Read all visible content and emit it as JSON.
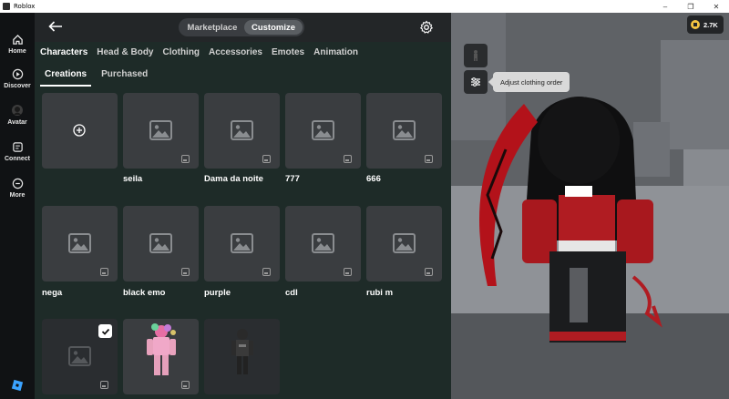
{
  "window": {
    "title": "Roblox"
  },
  "nav": {
    "items": [
      {
        "label": "Home",
        "icon": "home-icon"
      },
      {
        "label": "Discover",
        "icon": "discover-icon"
      },
      {
        "label": "Avatar",
        "icon": "avatar-icon"
      },
      {
        "label": "Connect",
        "icon": "connect-icon"
      },
      {
        "label": "More",
        "icon": "more-icon"
      }
    ]
  },
  "header": {
    "segment": {
      "marketplace": "Marketplace",
      "customize": "Customize",
      "selected": "Customize"
    }
  },
  "tabs": {
    "items": [
      "Characters",
      "Head & Body",
      "Clothing",
      "Accessories",
      "Emotes",
      "Animation"
    ],
    "active": "Characters"
  },
  "subtabs": {
    "items": [
      "Creations",
      "Purchased"
    ],
    "active": "Creations"
  },
  "creations": {
    "names": [
      "seila",
      "Dama da noite",
      "777",
      "666",
      "nega",
      "black emo",
      "purple",
      "cdl",
      "rubi m"
    ]
  },
  "robux": {
    "balance": "2.7K"
  },
  "tooltip": {
    "text": "Adjust clothing order"
  },
  "colors": {
    "accent": "#ffffff",
    "coin": "#f4c542",
    "panel": "#1e2b28"
  }
}
